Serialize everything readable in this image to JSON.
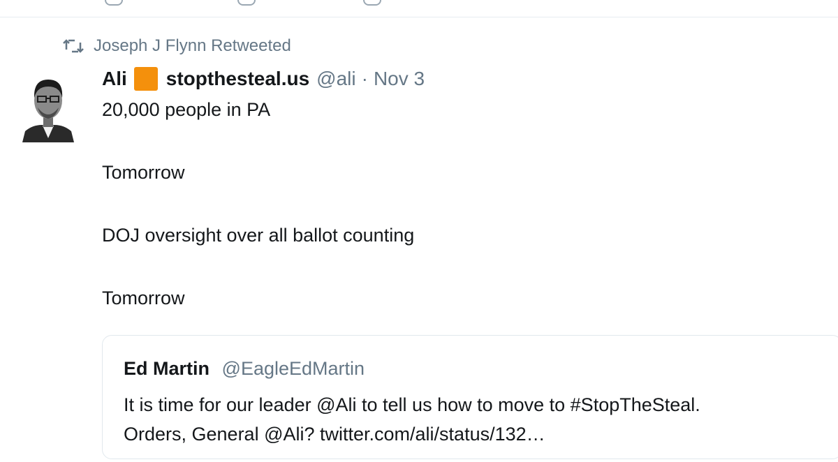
{
  "retweet_bar": {
    "icon": "retweet-icon",
    "label": "Joseph J Flynn Retweeted"
  },
  "tweet": {
    "avatar": "avatar-photo",
    "display_name": "Ali",
    "name_badge_color": "#f4900c",
    "site_name": "stopthesteal.us",
    "handle": "@ali",
    "separator": "·",
    "date": "Nov 3",
    "paragraphs": [
      "20,000 people in PA",
      "Tomorrow",
      "DOJ oversight over all ballot counting",
      "Tomorrow"
    ]
  },
  "quoted_tweet": {
    "display_name": "Ed Martin",
    "handle": "@EagleEdMartin",
    "lines": [
      "It is time for our leader @Ali to tell us how to move to #StopTheSteal.",
      "Orders, General @Ali? twitter.com/ali/status/132…"
    ]
  },
  "colors": {
    "text": "#14171a",
    "secondary": "#657786",
    "border": "#e1e8ed"
  }
}
